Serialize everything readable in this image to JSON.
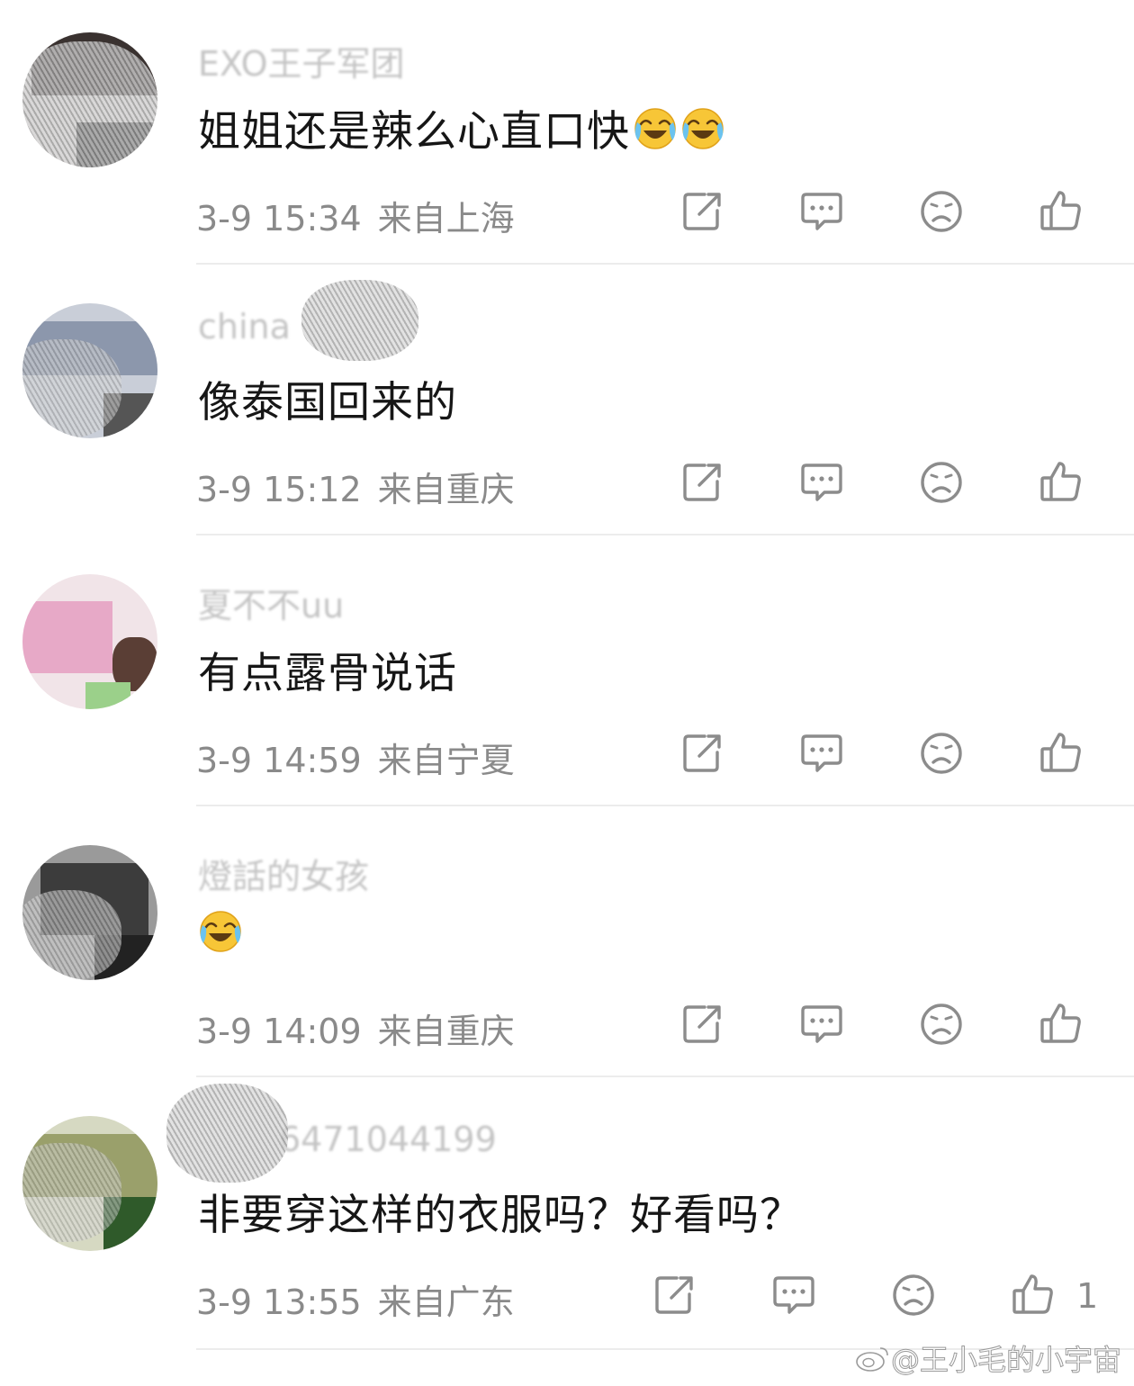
{
  "comments": [
    {
      "username": "EXO王子军团",
      "text": "姐姐还是辣么心直口快",
      "emoji_count": 2,
      "time": "3-9 15:34",
      "location": "来自上海",
      "like_count": ""
    },
    {
      "username": "china",
      "text": "像泰国回来的",
      "emoji_count": 0,
      "time": "3-9 15:12",
      "location": "来自重庆",
      "like_count": ""
    },
    {
      "username": "夏不不uu",
      "text": "有点露骨说话",
      "emoji_count": 0,
      "time": "3-9 14:59",
      "location": "来自宁夏",
      "like_count": ""
    },
    {
      "username": "燈話的女孩",
      "text": "",
      "emoji_count": 1,
      "time": "3-9 14:09",
      "location": "来自重庆",
      "like_count": ""
    },
    {
      "username": "6471044199",
      "text": "非要穿这样的衣服吗？好看吗？",
      "emoji_count": 0,
      "time": "3-9 13:55",
      "location": "来自广东",
      "like_count": "1"
    }
  ],
  "icons": {
    "share": "share-icon",
    "reply": "comment-icon",
    "dislike": "sad-face-icon",
    "like": "thumbs-up-icon",
    "emoji": "laugh-cry-emoji"
  },
  "watermark": "@王小毛的小宇宙",
  "colors": {
    "text": "#161616",
    "meta": "#8a8a8a",
    "icon": "#8c8c8c",
    "divider": "#ececec"
  }
}
